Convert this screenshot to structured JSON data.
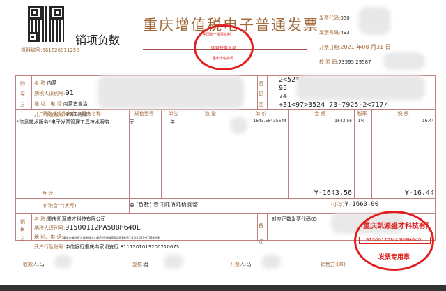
{
  "header": {
    "title": "重庆增值税电子普通发票",
    "negative_label": "销项负数",
    "machine_no_label": "机器编号:",
    "machine_no": "661626811250",
    "invoice_code_label": "发票代码:",
    "invoice_code": "050",
    "invoice_no_label": "发票号码:",
    "invoice_no": "493",
    "date_label": "开票日期:",
    "date": "2021 年08 月31 日",
    "check_label": "校 验 码:",
    "check_code": "73595 29587"
  },
  "stamp_top": {
    "line1": "全国统一发票监制",
    "line2": "国家税务总局",
    "line3": "重庆市税务局"
  },
  "buyer": {
    "section": "购买方",
    "name_label": "名      称:",
    "name": "内蒙",
    "tax_id_label": "纳税人识别号:",
    "tax_id": "91",
    "addr_label": "地 址、电 话:",
    "addr": "内蒙古自治",
    "bank_label": "开户行及账号:",
    "bank": "中国工商银行"
  },
  "cipher": {
    "section": "密码区",
    "lines": [
      "2<52*7",
      "95",
      "74",
      "+31<97>3524  73-7925-2<717/"
    ]
  },
  "items": {
    "headers": [
      "货物或应税劳务、服务名称",
      "规格型号",
      "单位",
      "数 量",
      "单 价",
      "金 额",
      "税率",
      "税 额"
    ],
    "rows": [
      {
        "name": "*信息技术服务*电子发票管理工具技术服务",
        "spec": "无",
        "unit": "年",
        "qty": "-",
        "price": "1643.56435644",
        "amount": "-1643.56",
        "rate": "1%",
        "tax": "-16.44"
      }
    ],
    "total_label": "合      计",
    "total_amount": "¥-1643.56",
    "total_tax": "¥-16.44"
  },
  "grand": {
    "label": "价税合计(大写)",
    "words": "(负数) 壹仟陆佰陆拾圆整",
    "small_label": "(小写)",
    "small": "¥-1660.00"
  },
  "seller": {
    "section": "销售方",
    "name_label": "名      称:",
    "name": "重庆凯源盛才科技有限公司",
    "tax_id_label": "纳税人识别号:",
    "tax_id": "91500112MA5UBH640L",
    "addr_label": "地 址、电 话:",
    "addr": "重庆市渝北区龙溪街道龙山路70号新城国际2幢1单元1-1号4 023-67398098",
    "bank_label": "开户行及账号:",
    "bank": "中信银行重庆冉家坝支行 8111201013200210673"
  },
  "remark": {
    "section": "备注",
    "text": "对应正数发票代码05"
  },
  "footer": {
    "payee_label": "收款人:",
    "payee": "马",
    "reviewer_label": "复核:",
    "reviewer": "肖",
    "drawer_label": "开票人:",
    "drawer": "马",
    "seller_label": "销售方:(章)"
  },
  "seller_stamp": {
    "company": "重庆凯源盛才科技有限公司",
    "tax_id": "91500112MA5UBH640L",
    "text": "发票专用章"
  }
}
